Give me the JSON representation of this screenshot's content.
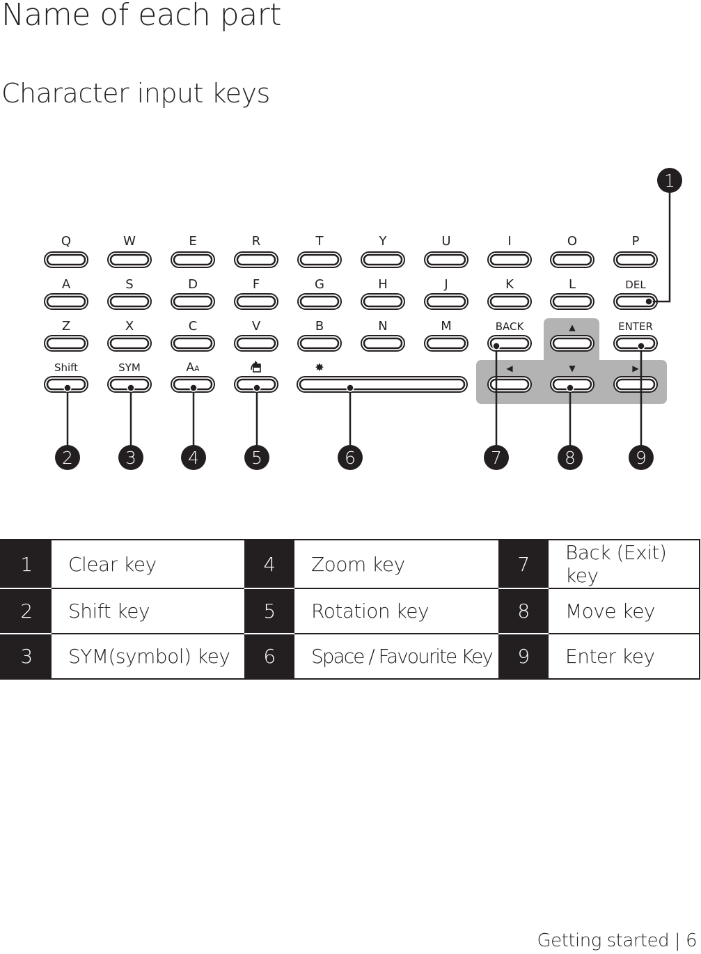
{
  "page": {
    "title": "Name of each part",
    "subtitle": "Character input keys",
    "footer": "Getting started | 6"
  },
  "keyboard": {
    "rows": [
      [
        "Q",
        "W",
        "E",
        "R",
        "T",
        "Y",
        "U",
        "I",
        "O",
        "P"
      ],
      [
        "A",
        "S",
        "D",
        "F",
        "G",
        "H",
        "J",
        "K",
        "L",
        "DEL"
      ],
      [
        "Z",
        "X",
        "C",
        "V",
        "B",
        "N",
        "M",
        "BACK",
        "▲",
        "ENTER"
      ],
      [
        "Shift",
        "SYM",
        "zoom-icon",
        "rotation-icon",
        "star-icon",
        "",
        "",
        "◀",
        "▼",
        "▶"
      ]
    ],
    "zoom_glyph": "AA",
    "highlight_color": "#b3b3b3",
    "callouts": [
      "1",
      "2",
      "3",
      "4",
      "5",
      "6",
      "7",
      "8",
      "9"
    ]
  },
  "legend": {
    "rows": [
      [
        {
          "num": "1",
          "label": "Clear key"
        },
        {
          "num": "4",
          "label": "Zoom key"
        },
        {
          "num": "7",
          "label": "Back (Exit) key"
        }
      ],
      [
        {
          "num": "2",
          "label": "Shift key"
        },
        {
          "num": "5",
          "label": "Rotation key"
        },
        {
          "num": "8",
          "label": "Move key"
        }
      ],
      [
        {
          "num": "3",
          "label": "SYM(symbol) key"
        },
        {
          "num": "6",
          "label": "Space / Favourite Key"
        },
        {
          "num": "9",
          "label": "Enter key"
        }
      ]
    ]
  }
}
